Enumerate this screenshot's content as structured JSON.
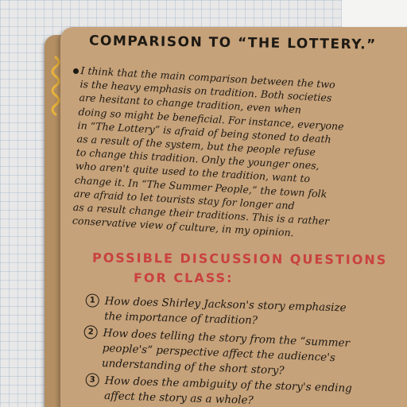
{
  "notebook": {
    "title": "COMPARISON TO “THE LOTTERY.”",
    "paragraph_lines": [
      "I think that the main comparison between the two",
      "is the heavy emphasis on tradition. Both societies",
      "are hesitant to change tradition, even when",
      "doing so might be beneficial. For instance, everyone",
      "in “The Lottery” is afraid of being stoned to death",
      "as a result of the system, but the people refuse",
      "to change this tradition. Only the younger ones,",
      "who aren't quite used to the tradition, want to",
      "change it. In “The Summer People,” the town folk",
      "are afraid to let tourists stay for longer and",
      "as a result change their traditions. This is a rather",
      "conservative view of culture, in my opinion."
    ],
    "subheading_line1": "POSSIBLE DISCUSSION QUESTIONS",
    "subheading_line2": "FOR CLASS:",
    "questions": [
      {
        "number": "1",
        "lines": [
          "How does Shirley Jackson's story emphasize",
          "the importance of tradition?"
        ]
      },
      {
        "number": "2",
        "lines": [
          "How does telling the story from the “summer",
          "people's” perspective affect the audience's",
          "understanding of the short story?"
        ]
      },
      {
        "number": "3",
        "lines": [
          "How does the ambiguity of the story's ending",
          "affect the story as a whole?"
        ]
      }
    ],
    "colors": {
      "ink": "#1d1913",
      "red_ink": "#c9413f",
      "kraft_page": "#c6a27a",
      "yellow_doodle": "#e8b23c"
    }
  }
}
